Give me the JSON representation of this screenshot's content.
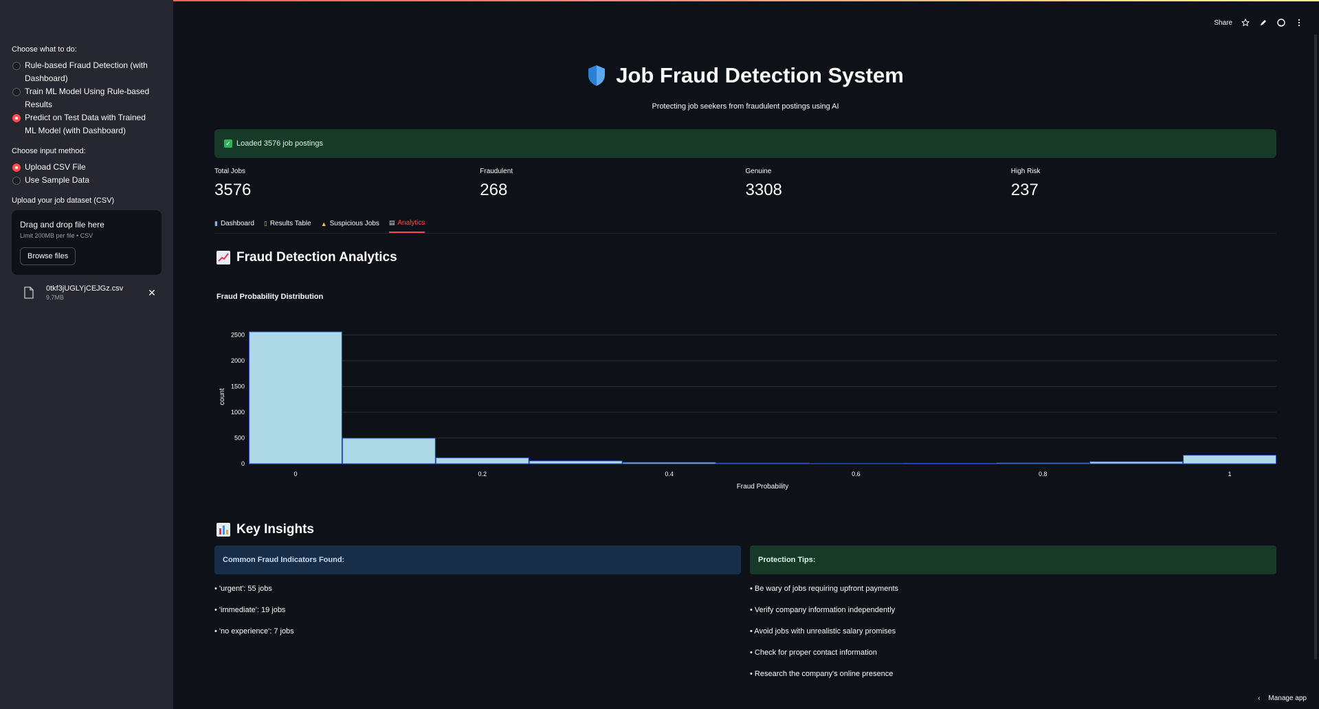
{
  "sidebar": {
    "task_label": "Choose what to do:",
    "task_options": [
      {
        "label": "Rule-based Fraud Detection (with Dashboard)",
        "selected": false
      },
      {
        "label": "Train ML Model Using Rule-based Results",
        "selected": false
      },
      {
        "label": "Predict on Test Data with Trained ML Model (with Dashboard)",
        "selected": true
      }
    ],
    "input_label": "Choose input method:",
    "input_options": [
      {
        "label": "Upload CSV File",
        "selected": true
      },
      {
        "label": "Use Sample Data",
        "selected": false
      }
    ],
    "upload_label": "Upload your job dataset (CSV)",
    "upload_title": "Drag and drop file here",
    "upload_limit": "Limit 200MB per file • CSV",
    "browse_label": "Browse files",
    "file_name": "0tkf3jUGLYjCEJGz.csv",
    "file_size": "9.7MB"
  },
  "topbar": {
    "share_label": "Share"
  },
  "header": {
    "title": "Job Fraud Detection System",
    "subtitle": "Protecting job seekers from fraudulent postings using AI"
  },
  "alert": {
    "text": "Loaded 3576 job postings"
  },
  "metrics": [
    {
      "label": "Total Jobs",
      "value": "3576"
    },
    {
      "label": "Fraudulent",
      "value": "268"
    },
    {
      "label": "Genuine",
      "value": "3308"
    },
    {
      "label": "High Risk",
      "value": "237"
    }
  ],
  "tabs": [
    {
      "label": "Dashboard",
      "active": false
    },
    {
      "label": "Results Table",
      "active": false
    },
    {
      "label": "Suspicious Jobs",
      "active": false
    },
    {
      "label": "Analytics",
      "active": true
    }
  ],
  "analytics": {
    "title": "Fraud Detection Analytics"
  },
  "chart_data": {
    "type": "bar",
    "title": "Fraud Probability Distribution",
    "xlabel": "Fraud Probability",
    "ylabel": "count",
    "bin_width": 0.1,
    "bin_starts": [
      -0.05,
      0.05,
      0.15,
      0.25,
      0.35,
      0.45,
      0.55,
      0.65,
      0.75,
      0.85,
      0.95
    ],
    "values": [
      2560,
      495,
      115,
      55,
      25,
      12,
      5,
      8,
      15,
      40,
      165
    ],
    "xlim": [
      -0.05,
      1.05
    ],
    "ylim": [
      0,
      2600
    ],
    "x_ticks": [
      0,
      0.2,
      0.4,
      0.6,
      0.8,
      1
    ],
    "x_tick_labels": [
      "0",
      "0.2",
      "0.4",
      "0.6",
      "0.8",
      "1"
    ],
    "y_ticks": [
      0,
      500,
      1000,
      1500,
      2000,
      2500
    ],
    "y_tick_labels": [
      "0",
      "500",
      "1000",
      "1500",
      "2000",
      "2500"
    ],
    "bar_color": "#add8e6",
    "grid": true
  },
  "insights": {
    "title": "Key Insights",
    "indicators_title": "Common Fraud Indicators Found:",
    "indicators": [
      "• 'urgent': 55 jobs",
      "• 'immediate': 19 jobs",
      "• 'no experience': 7 jobs"
    ],
    "tips_title": "Protection Tips:",
    "tips": [
      "• Be wary of jobs requiring upfront payments",
      "• Verify company information independently",
      "• Avoid jobs with unrealistic salary promises",
      "• Check for proper contact information",
      "• Research the company's online presence"
    ]
  },
  "footer": {
    "manage_label": "Manage app"
  },
  "colors": {
    "accent": "#ff4b4b",
    "background": "#0e1117",
    "sidebar": "#262730",
    "success_bg": "#173928",
    "info_bg": "#172d48"
  }
}
